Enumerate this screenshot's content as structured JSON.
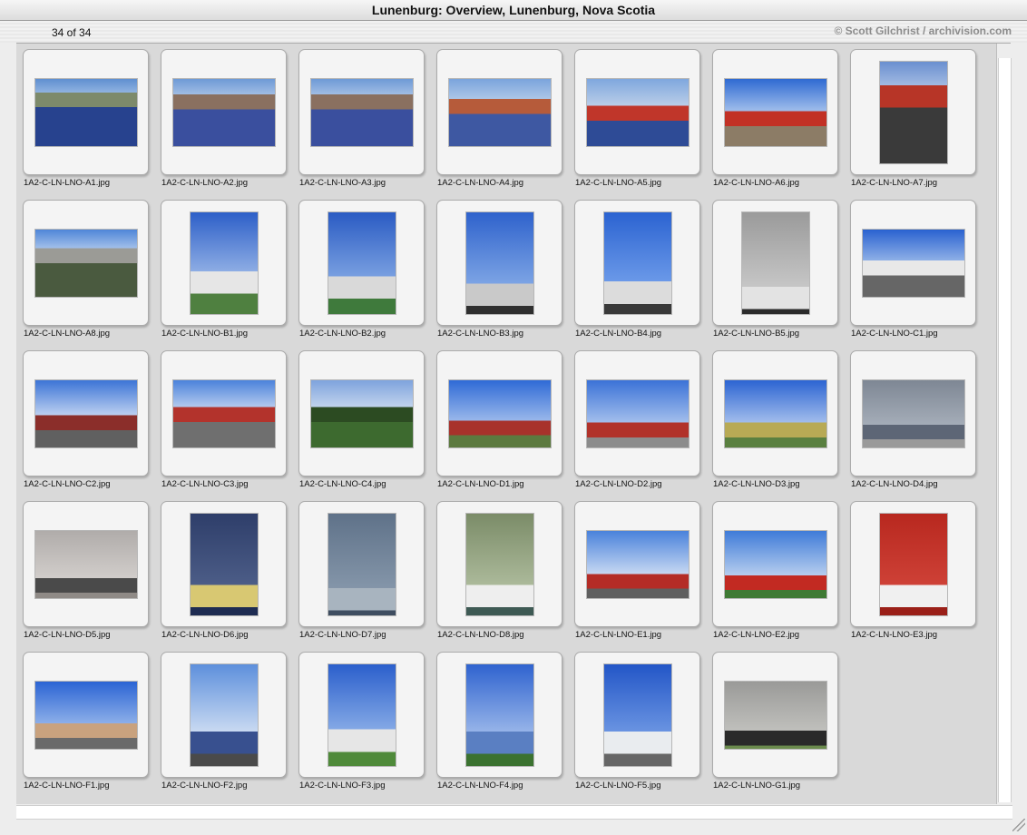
{
  "window": {
    "title": "Lunenburg: Overview, Lunenburg, Nova Scotia"
  },
  "header": {
    "count": "34 of 34",
    "copyright": "© Scott Gilchrist / archivision.com"
  },
  "slides": [
    {
      "filename": "1A2-C-LN-LNO-A1.jpg",
      "orientation": "landscape",
      "scene": "harbor-water"
    },
    {
      "filename": "1A2-C-LN-LNO-A2.jpg",
      "orientation": "landscape",
      "scene": "harbor-town"
    },
    {
      "filename": "1A2-C-LN-LNO-A3.jpg",
      "orientation": "landscape",
      "scene": "harbor-town"
    },
    {
      "filename": "1A2-C-LN-LNO-A4.jpg",
      "orientation": "landscape",
      "scene": "harbor-town-colorful"
    },
    {
      "filename": "1A2-C-LN-LNO-A5.jpg",
      "orientation": "landscape",
      "scene": "harbor-red-buildings"
    },
    {
      "filename": "1A2-C-LN-LNO-A6.jpg",
      "orientation": "landscape",
      "scene": "wharf-red"
    },
    {
      "filename": "1A2-C-LN-LNO-A7.jpg",
      "orientation": "portrait",
      "scene": "boats-dock"
    },
    {
      "filename": "1A2-C-LN-LNO-A8.jpg",
      "orientation": "landscape",
      "scene": "shed-water"
    },
    {
      "filename": "1A2-C-LN-LNO-B1.jpg",
      "orientation": "portrait",
      "scene": "white-church"
    },
    {
      "filename": "1A2-C-LN-LNO-B2.jpg",
      "orientation": "portrait",
      "scene": "white-church-spires"
    },
    {
      "filename": "1A2-C-LN-LNO-B3.jpg",
      "orientation": "portrait",
      "scene": "church-windows"
    },
    {
      "filename": "1A2-C-LN-LNO-B4.jpg",
      "orientation": "portrait",
      "scene": "church-tower"
    },
    {
      "filename": "1A2-C-LN-LNO-B5.jpg",
      "orientation": "portrait",
      "scene": "church-window-detail"
    },
    {
      "filename": "1A2-C-LN-LNO-C1.jpg",
      "orientation": "landscape",
      "scene": "street-white"
    },
    {
      "filename": "1A2-C-LN-LNO-C2.jpg",
      "orientation": "landscape",
      "scene": "street-brick"
    },
    {
      "filename": "1A2-C-LN-LNO-C3.jpg",
      "orientation": "landscape",
      "scene": "street-cars"
    },
    {
      "filename": "1A2-C-LN-LNO-C4.jpg",
      "orientation": "landscape",
      "scene": "park-trees"
    },
    {
      "filename": "1A2-C-LN-LNO-D1.jpg",
      "orientation": "landscape",
      "scene": "red-house"
    },
    {
      "filename": "1A2-C-LN-LNO-D2.jpg",
      "orientation": "landscape",
      "scene": "red-house-flag"
    },
    {
      "filename": "1A2-C-LN-LNO-D3.jpg",
      "orientation": "landscape",
      "scene": "yellow-house"
    },
    {
      "filename": "1A2-C-LN-LNO-D4.jpg",
      "orientation": "landscape",
      "scene": "gray-facade"
    },
    {
      "filename": "1A2-C-LN-LNO-D5.jpg",
      "orientation": "landscape",
      "scene": "gray-siding"
    },
    {
      "filename": "1A2-C-LN-LNO-D6.jpg",
      "orientation": "portrait",
      "scene": "doorway-blue"
    },
    {
      "filename": "1A2-C-LN-LNO-D7.jpg",
      "orientation": "portrait",
      "scene": "gray-door"
    },
    {
      "filename": "1A2-C-LN-LNO-D8.jpg",
      "orientation": "portrait",
      "scene": "window-green"
    },
    {
      "filename": "1A2-C-LN-LNO-E1.jpg",
      "orientation": "landscape",
      "scene": "red-row"
    },
    {
      "filename": "1A2-C-LN-LNO-E2.jpg",
      "orientation": "landscape",
      "scene": "red-building-sign"
    },
    {
      "filename": "1A2-C-LN-LNO-E3.jpg",
      "orientation": "portrait",
      "scene": "red-wall-window"
    },
    {
      "filename": "1A2-C-LN-LNO-F1.jpg",
      "orientation": "landscape",
      "scene": "house-corner"
    },
    {
      "filename": "1A2-C-LN-LNO-F2.jpg",
      "orientation": "portrait",
      "scene": "blue-house-tall"
    },
    {
      "filename": "1A2-C-LN-LNO-F3.jpg",
      "orientation": "portrait",
      "scene": "white-house-trees"
    },
    {
      "filename": "1A2-C-LN-LNO-F4.jpg",
      "orientation": "portrait",
      "scene": "blue-house-stairs"
    },
    {
      "filename": "1A2-C-LN-LNO-F5.jpg",
      "orientation": "portrait",
      "scene": "white-house-blue-sky"
    },
    {
      "filename": "1A2-C-LN-LNO-G1.jpg",
      "orientation": "landscape",
      "scene": "plaque"
    }
  ]
}
